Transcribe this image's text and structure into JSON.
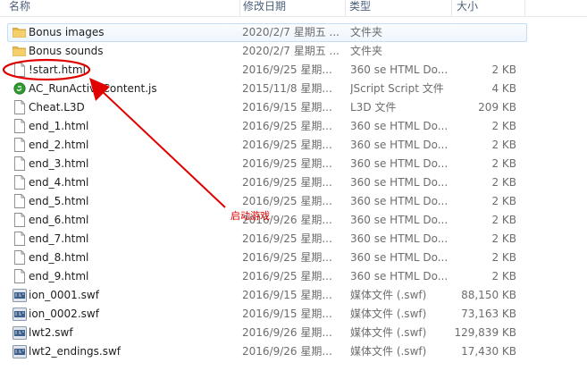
{
  "columns": {
    "name": "名称",
    "date": "修改日期",
    "type": "类型",
    "size": "大小"
  },
  "files": [
    {
      "name": "Bonus images",
      "date": "2020/2/7 星期五 ...",
      "type": "文件夹",
      "size": "",
      "icon": "folder-icon",
      "selected": true
    },
    {
      "name": "Bonus sounds",
      "date": "2020/2/7 星期五 ...",
      "type": "文件夹",
      "size": "",
      "icon": "folder-icon",
      "selected": false
    },
    {
      "name": "!start.html",
      "date": "2016/9/25 星期...",
      "type": "360 se HTML Do...",
      "size": "2 KB",
      "icon": "html-file-icon",
      "selected": false
    },
    {
      "name": "AC_RunActiveContent.js",
      "date": "2015/11/8 星期...",
      "type": "JScript Script 文件",
      "size": "4 KB",
      "icon": "js-file-icon",
      "selected": false
    },
    {
      "name": "Cheat.L3D",
      "date": "2016/9/15 星期...",
      "type": "L3D 文件",
      "size": "209 KB",
      "icon": "file-icon",
      "selected": false
    },
    {
      "name": "end_1.html",
      "date": "2016/9/25 星期...",
      "type": "360 se HTML Do...",
      "size": "2 KB",
      "icon": "html-file-icon",
      "selected": false
    },
    {
      "name": "end_2.html",
      "date": "2016/9/25 星期...",
      "type": "360 se HTML Do...",
      "size": "2 KB",
      "icon": "html-file-icon",
      "selected": false
    },
    {
      "name": "end_3.html",
      "date": "2016/9/25 星期...",
      "type": "360 se HTML Do...",
      "size": "2 KB",
      "icon": "html-file-icon",
      "selected": false
    },
    {
      "name": "end_4.html",
      "date": "2016/9/25 星期...",
      "type": "360 se HTML Do...",
      "size": "2 KB",
      "icon": "html-file-icon",
      "selected": false
    },
    {
      "name": "end_5.html",
      "date": "2016/9/25 星期...",
      "type": "360 se HTML Do...",
      "size": "2 KB",
      "icon": "html-file-icon",
      "selected": false
    },
    {
      "name": "end_6.html",
      "date": "2016/9/26 星期...",
      "type": "360 se HTML Do...",
      "size": "2 KB",
      "icon": "html-file-icon",
      "selected": false
    },
    {
      "name": "end_7.html",
      "date": "2016/9/25 星期...",
      "type": "360 se HTML Do...",
      "size": "2 KB",
      "icon": "html-file-icon",
      "selected": false
    },
    {
      "name": "end_8.html",
      "date": "2016/9/25 星期...",
      "type": "360 se HTML Do...",
      "size": "2 KB",
      "icon": "html-file-icon",
      "selected": false
    },
    {
      "name": "end_9.html",
      "date": "2016/9/25 星期...",
      "type": "360 se HTML Do...",
      "size": "2 KB",
      "icon": "html-file-icon",
      "selected": false
    },
    {
      "name": "ion_0001.swf",
      "date": "2016/9/15 星期...",
      "type": "媒体文件 (.swf)",
      "size": "88,150 KB",
      "icon": "swf-file-icon",
      "selected": false
    },
    {
      "name": "ion_0002.swf",
      "date": "2016/9/15 星期...",
      "type": "媒体文件 (.swf)",
      "size": "73,163 KB",
      "icon": "swf-file-icon",
      "selected": false
    },
    {
      "name": "lwt2.swf",
      "date": "2016/9/26 星期...",
      "type": "媒体文件 (.swf)",
      "size": "129,839 KB",
      "icon": "swf-file-icon",
      "selected": false
    },
    {
      "name": "lwt2_endings.swf",
      "date": "2016/9/26 星期...",
      "type": "媒体文件 (.swf)",
      "size": "17,430 KB",
      "icon": "swf-file-icon",
      "selected": false
    }
  ],
  "annotation": {
    "label": "启动游戏",
    "color": "#e00000"
  },
  "colors": {
    "header_text": "#4c607a",
    "selection_border": "#c6ddf5",
    "folder": "#e8b84a"
  }
}
